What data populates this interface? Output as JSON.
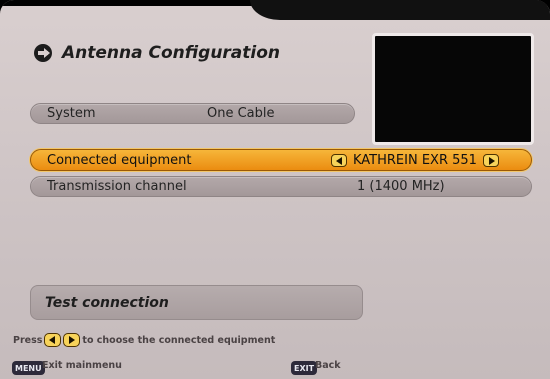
{
  "title": "Antenna Configuration",
  "system": {
    "label": "System",
    "value": "One Cable"
  },
  "connected_equipment": {
    "label": "Connected equipment",
    "value": "KATHREIN EXR 551"
  },
  "transmission_channel": {
    "label": "Transmission channel",
    "value": "1 (1400 MHz)"
  },
  "test_connection": {
    "label": "Test connection"
  },
  "hint": {
    "prefix": "Press",
    "suffix": "to choose the connected equipment"
  },
  "footer": {
    "menu_key": "MENU",
    "menu_label": "Exit mainmenu",
    "exit_key": "EXIT",
    "exit_label": "Back"
  },
  "icons": {
    "title": "antenna-icon",
    "left": "arrow-left-icon",
    "right": "arrow-right-icon"
  },
  "colors": {
    "highlight": "#eb8c10",
    "background": "#d9cfcf",
    "row": "#a39899"
  }
}
